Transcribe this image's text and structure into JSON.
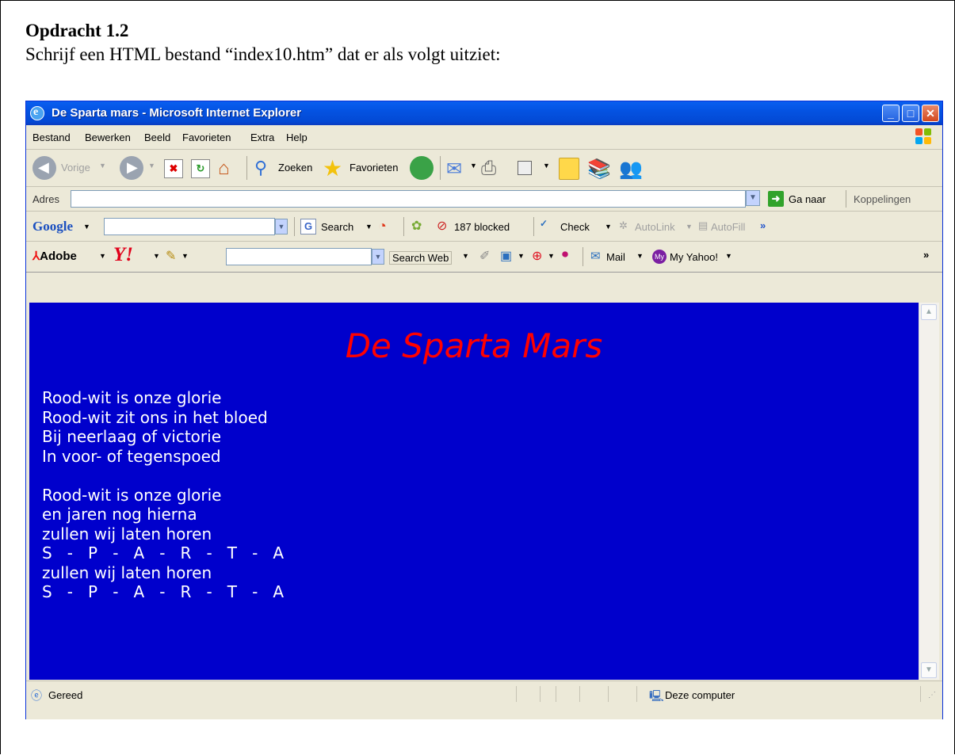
{
  "document": {
    "heading": "Opdracht 1.2",
    "instruction": "Schrijf een HTML bestand “index10.htm” dat er als volgt uitziet:"
  },
  "window": {
    "title": "De Sparta mars - Microsoft Internet Explorer"
  },
  "menu": [
    "Bestand",
    "Bewerken",
    "Beeld",
    "Favorieten",
    "Extra",
    "Help"
  ],
  "toolbar": {
    "back_label": "Vorige",
    "search_label": "Zoeken",
    "favorites_label": "Favorieten"
  },
  "address": {
    "label": "Adres",
    "value": "",
    "go_label": "Ga naar",
    "links_label": "Koppelingen"
  },
  "google_bar": {
    "logo": "Google",
    "search_label": "Search",
    "blocked_label": "187 blocked",
    "check_label": "Check",
    "autolink_label": "AutoLink",
    "autofill_label": "AutoFill"
  },
  "yahoo_bar": {
    "adobe_label": "Adobe",
    "yahoo_logo": "Y!",
    "search_web_label": "Search Web",
    "mail_label": "Mail",
    "my_yahoo_label": "My Yahoo!"
  },
  "page": {
    "title": "De Sparta Mars",
    "lines": [
      "Rood-wit is onze glorie",
      "Rood-wit zit ons in het bloed",
      "Bij neerlaag of victorie",
      "In voor- of tegenspoed",
      "",
      "Rood-wit is onze glorie",
      "en jaren nog hierna",
      "zullen wij laten horen",
      "S   -   P   -   A   -   R   -   T   -   A",
      "zullen wij laten horen",
      "S   -   P   -   A   -   R   -   T   -   A"
    ],
    "background_color": "#0000cc",
    "title_color": "#ff0000"
  },
  "status": {
    "text": "Gereed",
    "zone": "Deze computer"
  }
}
